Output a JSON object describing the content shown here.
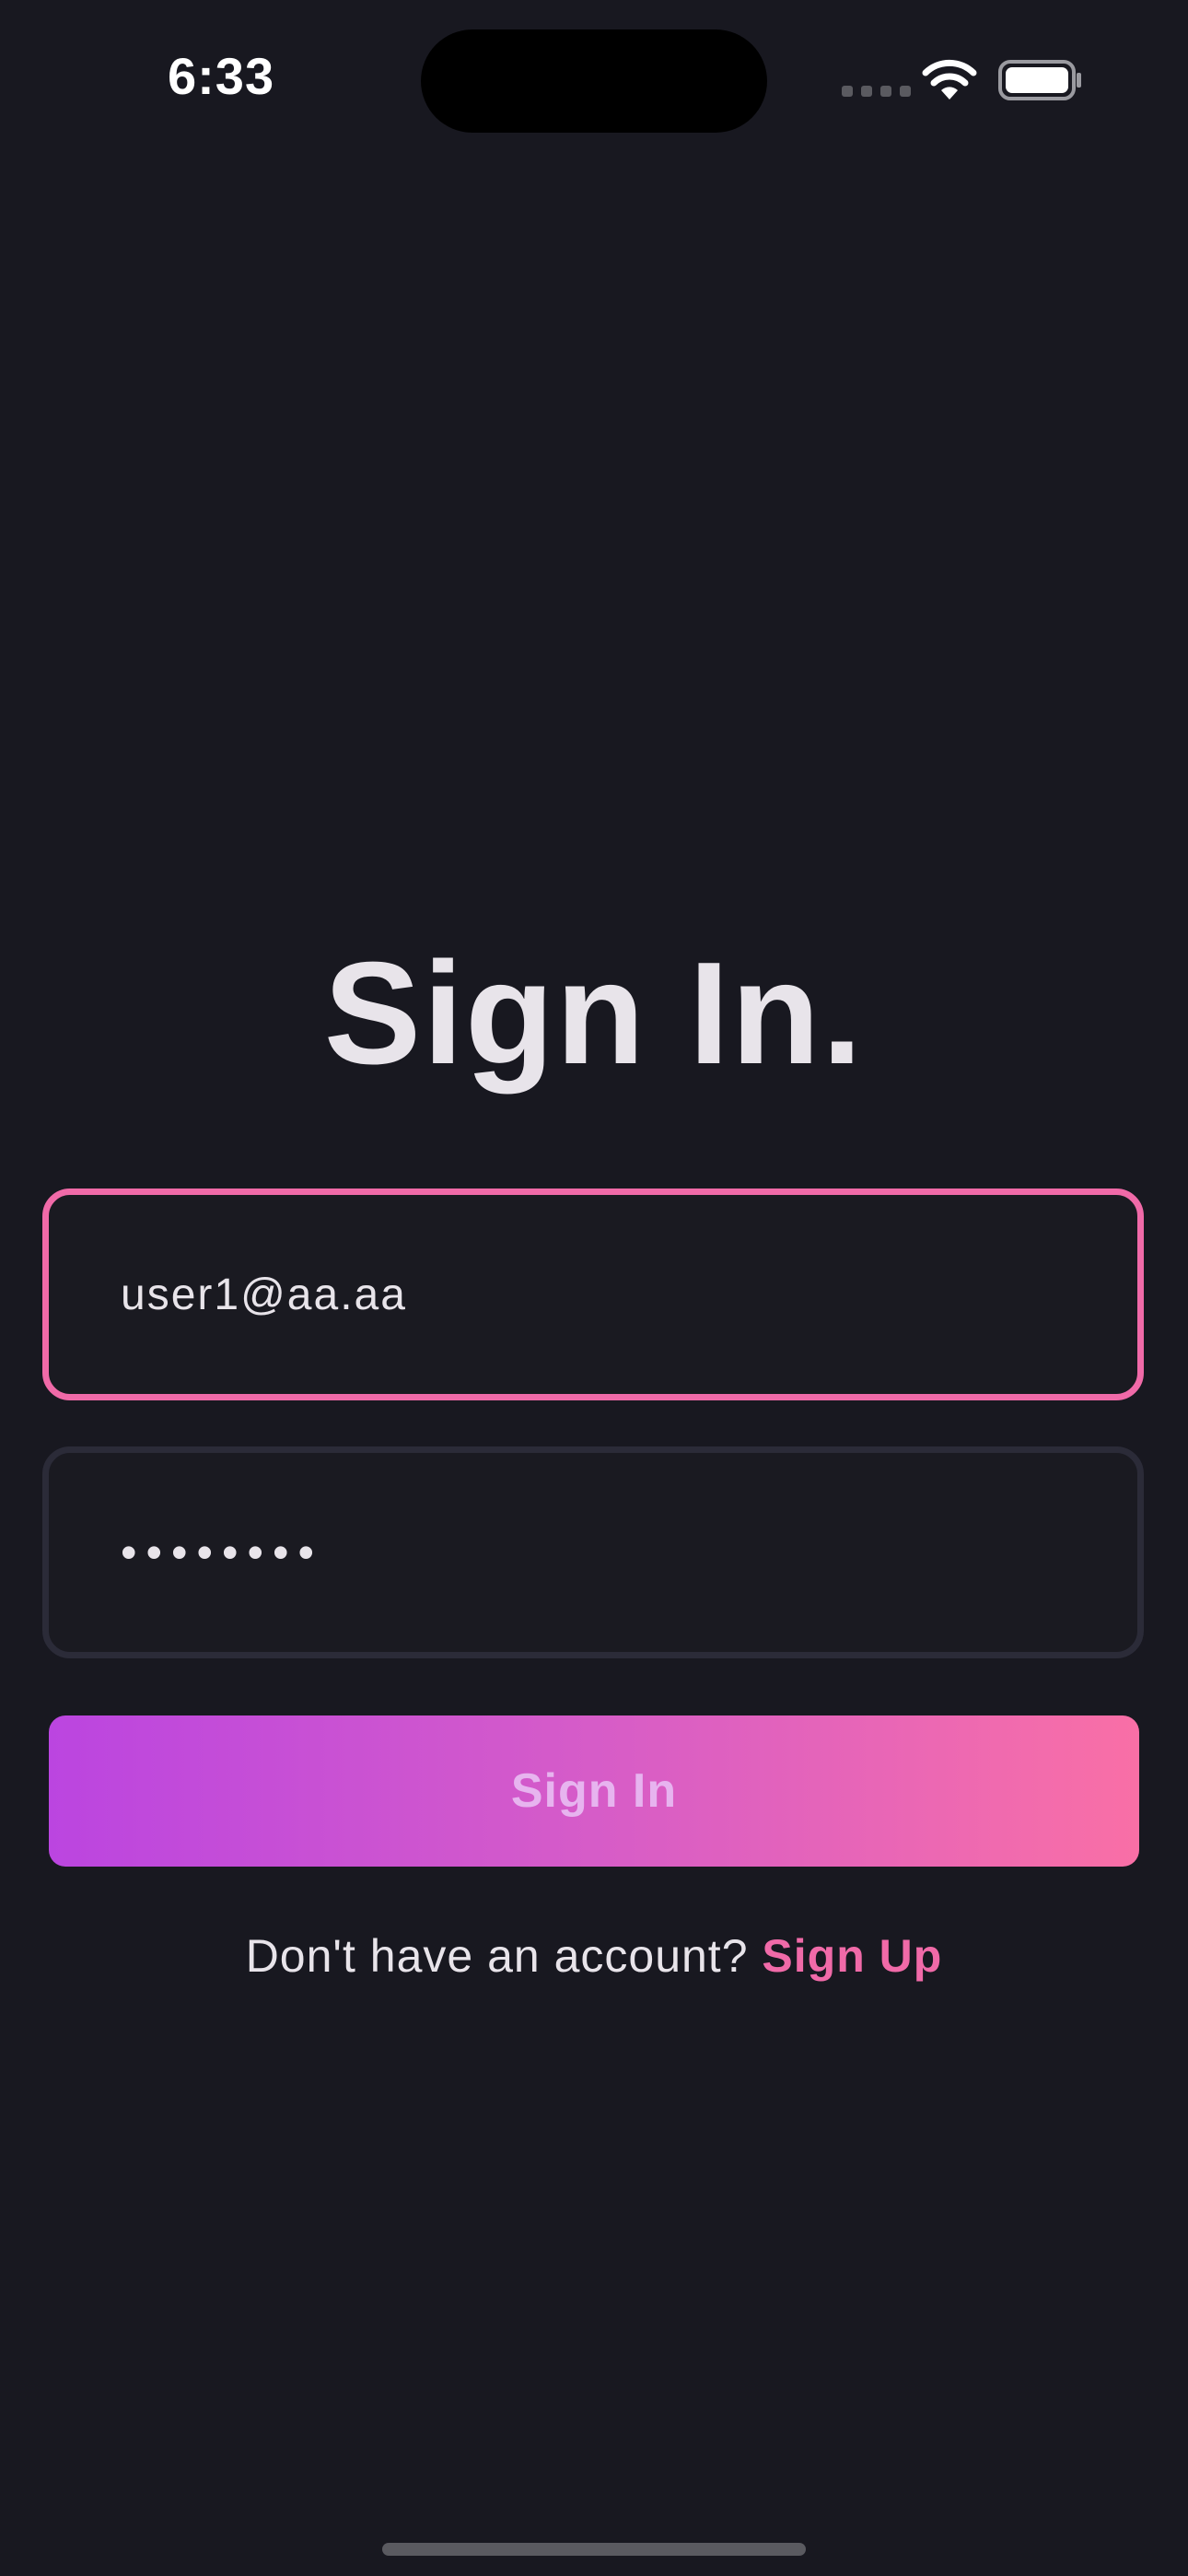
{
  "status_bar": {
    "time": "6:33",
    "icons": [
      "cellular-signal-icon",
      "wifi-icon",
      "battery-icon"
    ]
  },
  "screen": {
    "title": "Sign In."
  },
  "form": {
    "email": {
      "value": "user1@aa.aa"
    },
    "password": {
      "value": "••••••••"
    },
    "submit_label": "Sign In"
  },
  "footer": {
    "prompt": "Don't have an account?",
    "link_label": "Sign Up"
  },
  "colors": {
    "background": "#181820",
    "accent_pink": "#f06aa8",
    "gradient_start": "#bb45e0",
    "gradient_end": "#f96fa6",
    "text": "#e8e4ea",
    "inactive_border": "#2b2b38"
  }
}
